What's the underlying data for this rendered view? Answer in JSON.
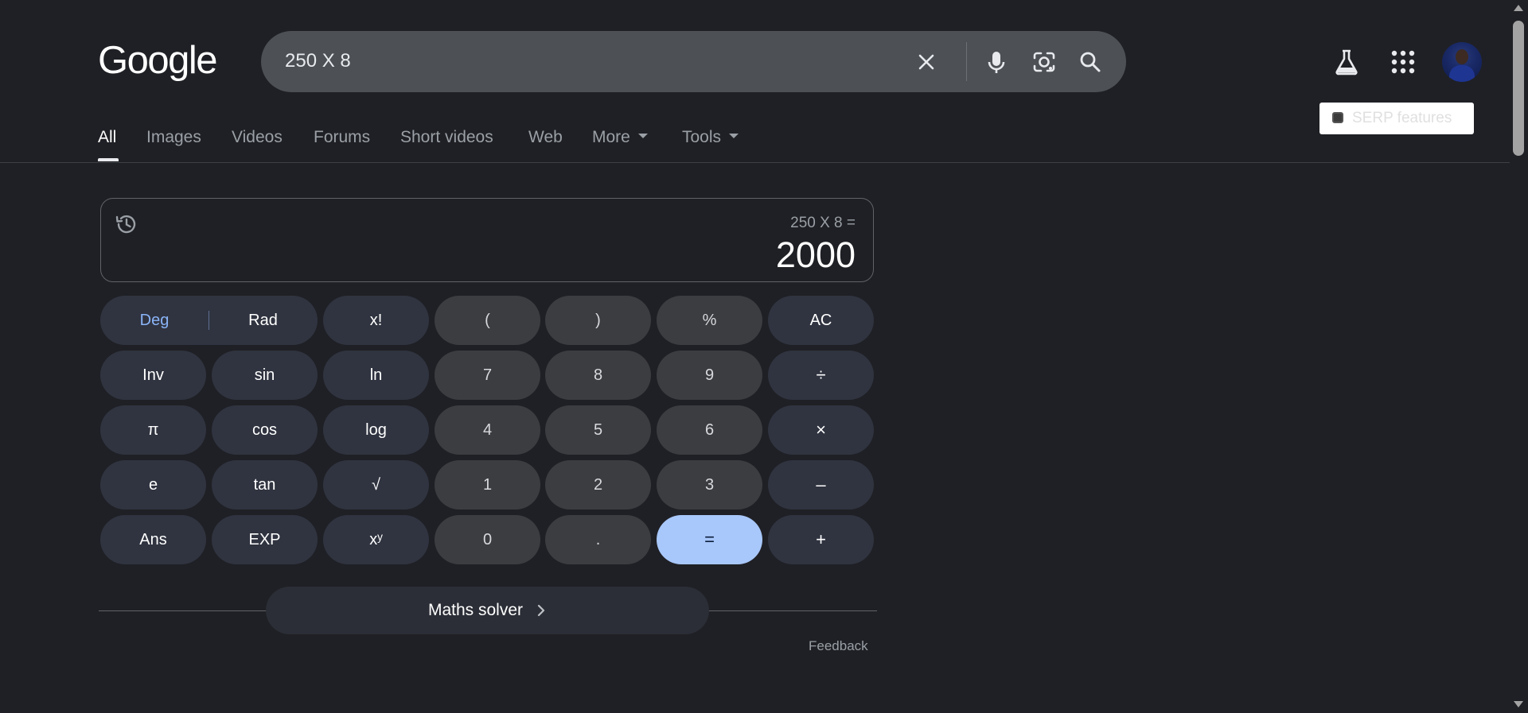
{
  "header": {
    "logo": "Google",
    "search": {
      "query": "250 X 8"
    },
    "serp_features_label": "SERP features"
  },
  "tabs": [
    {
      "label": "All"
    },
    {
      "label": "Images"
    },
    {
      "label": "Videos"
    },
    {
      "label": "Forums"
    },
    {
      "label": "Short videos"
    },
    {
      "label": "Web"
    },
    {
      "label": "More"
    },
    {
      "label": "Tools"
    }
  ],
  "calculator": {
    "expression": "250 X 8 =",
    "result": "2000",
    "deg_label": "Deg",
    "rad_label": "Rad",
    "keys": {
      "fact": "x!",
      "lparen": "(",
      "rparen": ")",
      "percent": "%",
      "ac": "AC",
      "inv": "Inv",
      "sin": "sin",
      "ln": "ln",
      "seven": "7",
      "eight": "8",
      "nine": "9",
      "divide": "÷",
      "pi": "π",
      "cos": "cos",
      "log": "log",
      "four": "4",
      "five": "5",
      "six": "6",
      "multiply": "×",
      "e": "e",
      "tan": "tan",
      "sqrt": "√",
      "one": "1",
      "two": "2",
      "three": "3",
      "minus": "–",
      "ans": "Ans",
      "exp": "EXP",
      "pow": "xʸ",
      "zero": "0",
      "dot": ".",
      "equals": "=",
      "plus": "+"
    },
    "maths_solver_label": "Maths solver",
    "feedback_label": "Feedback"
  },
  "colors": {
    "background": "#1f2025",
    "search_bar": "#4d5156",
    "function_key": "#303440",
    "number_key": "#3c3d41",
    "equals_key": "#a8c7fa",
    "deg_active": "#8ab4f8"
  },
  "icons": {
    "clear": "close-icon",
    "voice": "microphone-icon",
    "lens": "camera-lens-icon",
    "search": "search-icon",
    "labs": "flask-icon",
    "apps": "apps-grid-icon",
    "history": "history-icon",
    "solver": "chevron-right-icon"
  }
}
